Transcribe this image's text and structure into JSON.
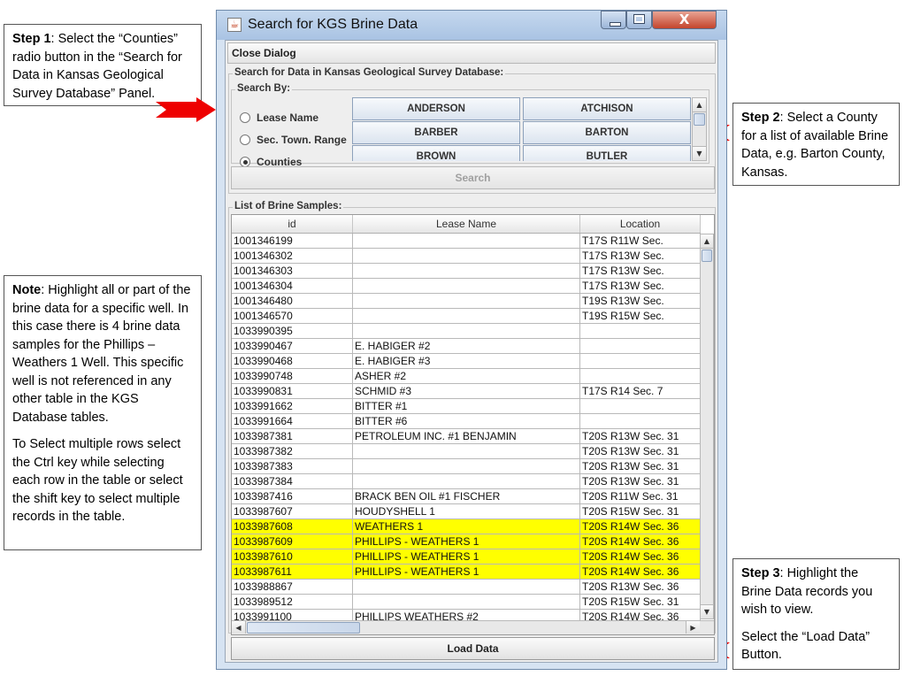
{
  "window": {
    "title": "Search for KGS Brine Data",
    "close_glyph": "X"
  },
  "close_dialog_label": "Close Dialog",
  "search_panel": {
    "title": "Search for Data in Kansas Geological Survey Database:",
    "search_by_label": "Search By:",
    "radios": [
      {
        "label": "Lease Name",
        "selected": false
      },
      {
        "label": "Sec. Town. Range",
        "selected": false
      },
      {
        "label": "Counties",
        "selected": true
      }
    ],
    "counties": [
      "ANDERSON",
      "ATCHISON",
      "BARBER",
      "BARTON",
      "BROWN",
      "BUTLER"
    ],
    "search_label": "Search"
  },
  "samples_panel": {
    "title": "List of Brine Samples:",
    "columns": [
      "id",
      "Lease Name",
      "Location"
    ],
    "rows": [
      {
        "id": "1001346199",
        "lease": "",
        "location": "T17S R11W Sec.",
        "selected": false
      },
      {
        "id": "1001346302",
        "lease": "",
        "location": "T17S R13W Sec.",
        "selected": false
      },
      {
        "id": "1001346303",
        "lease": "",
        "location": "T17S R13W Sec.",
        "selected": false
      },
      {
        "id": "1001346304",
        "lease": "",
        "location": "T17S R13W Sec.",
        "selected": false
      },
      {
        "id": "1001346480",
        "lease": "",
        "location": "T19S R13W Sec.",
        "selected": false
      },
      {
        "id": "1001346570",
        "lease": "",
        "location": "T19S R15W Sec.",
        "selected": false
      },
      {
        "id": "1033990395",
        "lease": "",
        "location": "",
        "selected": false
      },
      {
        "id": "1033990467",
        "lease": "E. HABIGER #2",
        "location": "",
        "selected": false
      },
      {
        "id": "1033990468",
        "lease": "E. HABIGER #3",
        "location": "",
        "selected": false
      },
      {
        "id": "1033990748",
        "lease": "ASHER #2",
        "location": "",
        "selected": false
      },
      {
        "id": "1033990831",
        "lease": "SCHMID #3",
        "location": "T17S R14 Sec. 7",
        "selected": false
      },
      {
        "id": "1033991662",
        "lease": "BITTER #1",
        "location": "",
        "selected": false
      },
      {
        "id": "1033991664",
        "lease": "BITTER #6",
        "location": "",
        "selected": false
      },
      {
        "id": "1033987381",
        "lease": "PETROLEUM INC. #1 BENJAMIN",
        "location": "T20S R13W Sec. 31",
        "selected": false
      },
      {
        "id": "1033987382",
        "lease": "",
        "location": "T20S R13W Sec. 31",
        "selected": false
      },
      {
        "id": "1033987383",
        "lease": "",
        "location": "T20S R13W Sec. 31",
        "selected": false
      },
      {
        "id": "1033987384",
        "lease": "",
        "location": "T20S R13W Sec. 31",
        "selected": false
      },
      {
        "id": "1033987416",
        "lease": "BRACK BEN OIL #1 FISCHER",
        "location": "T20S R11W Sec. 31",
        "selected": false
      },
      {
        "id": "1033987607",
        "lease": "HOUDYSHELL 1",
        "location": "T20S R15W Sec. 31",
        "selected": false
      },
      {
        "id": "1033987608",
        "lease": "WEATHERS 1",
        "location": "T20S R14W Sec. 36",
        "selected": true
      },
      {
        "id": "1033987609",
        "lease": "PHILLIPS - WEATHERS 1",
        "location": "T20S R14W Sec. 36",
        "selected": true
      },
      {
        "id": "1033987610",
        "lease": "PHILLIPS - WEATHERS 1",
        "location": "T20S R14W Sec. 36",
        "selected": true
      },
      {
        "id": "1033987611",
        "lease": "PHILLIPS - WEATHERS 1",
        "location": "T20S R14W Sec. 36",
        "selected": true
      },
      {
        "id": "1033988867",
        "lease": "",
        "location": "T20S R13W Sec. 36",
        "selected": false
      },
      {
        "id": "1033989512",
        "lease": "",
        "location": "T20S R15W Sec. 31",
        "selected": false
      },
      {
        "id": "1033991100",
        "lease": "PHILLIPS WEATHERS #2",
        "location": "T20S R14W Sec. 36",
        "selected": false
      }
    ]
  },
  "load_data_label": "Load Data",
  "notes": {
    "step1": {
      "heading": "Step 1",
      "text": ": Select the “Counties” radio button in the “Search for Data in Kansas Geological Survey Database” Panel."
    },
    "step2": {
      "heading": "Step 2",
      "text": ": Select a County for a list of available Brine Data, e.g. Barton County, Kansas."
    },
    "step3": {
      "heading": "Step 3",
      "text": ": Highlight the Brine Data records you wish to view.",
      "text2": "Select the “Load Data” Button."
    },
    "note": {
      "heading": "Note",
      "text": ": Highlight all or part of the brine data for a specific well. In this case there is 4 brine data samples for the Phillips – Weathers 1 Well. This specific well is not referenced in any other table in the KGS Database tables.",
      "text2": "To Select multiple rows select the Ctrl key while selecting each row in the table or select the shift key to select multiple records in the table."
    }
  },
  "colors": {
    "highlight": "#ffff00",
    "arrow": "#ee0000",
    "close_button": "#c4452d"
  }
}
